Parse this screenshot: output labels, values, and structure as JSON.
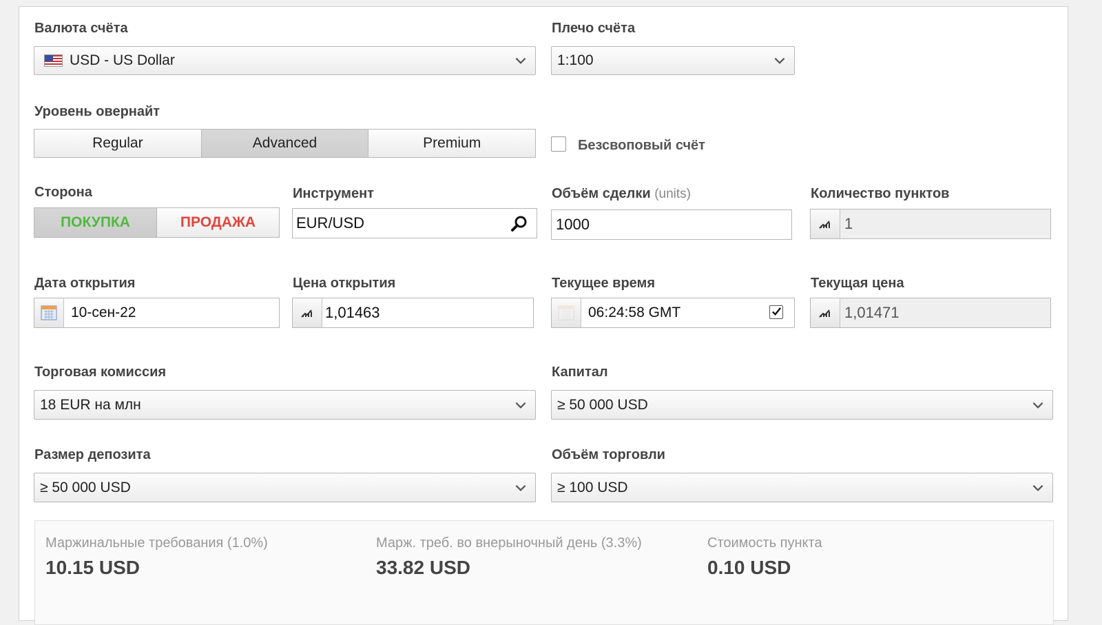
{
  "account_currency": {
    "label": "Валюта счёта",
    "value": "USD - US Dollar",
    "icon": "us-flag-icon"
  },
  "leverage": {
    "label": "Плечо счёта",
    "value": "1:100"
  },
  "overnight_level": {
    "label": "Уровень овернайт",
    "options": [
      "Regular",
      "Advanced",
      "Premium"
    ],
    "selected": "Advanced"
  },
  "swap_free": {
    "label": "Безсвоповый счёт",
    "checked": false
  },
  "side": {
    "label": "Сторона",
    "buy": "ПОКУПКА",
    "sell": "ПРОДАЖА",
    "selected": "buy",
    "buy_color": "#4dbb3c",
    "sell_color": "#e0463c"
  },
  "instrument": {
    "label": "Инструмент",
    "value": "EUR/USD",
    "icon": "search-icon"
  },
  "trade_volume": {
    "label": "Объём сделки",
    "unit": "(units)",
    "value": "1000"
  },
  "pips_count": {
    "label": "Количество пунктов",
    "value": "1",
    "icon": "chart-icon"
  },
  "open_date": {
    "label": "Дата открытия",
    "value": "10-сен-22",
    "icon": "calendar-icon"
  },
  "open_price": {
    "label": "Цена открытия",
    "value": "1,01463",
    "icon": "chart-icon"
  },
  "current_time": {
    "label": "Текущее время",
    "value": "06:24:58 GMT",
    "icon": "calendar-icon",
    "checked": true
  },
  "current_price": {
    "label": "Текущая цена",
    "value": "1,01471",
    "icon": "chart-icon"
  },
  "commission": {
    "label": "Торговая комиссия",
    "value": "18 EUR на млн"
  },
  "capital": {
    "label": "Капитал",
    "value": "≥ 50 000 USD"
  },
  "deposit": {
    "label": "Размер депозита",
    "value": "≥ 50 000 USD"
  },
  "trading_volume": {
    "label": "Объём торговли",
    "value": "≥ 100 USD"
  },
  "summary": {
    "margin": {
      "label": "Маржинальные требования (1.0%)",
      "value": "10.15 USD"
    },
    "margin_offmarket": {
      "label": "Марж. треб. во внерыночный день (3.3%)",
      "value": "33.82 USD"
    },
    "pip_value": {
      "label": "Стоимость пункта",
      "value": "0.10 USD"
    }
  }
}
